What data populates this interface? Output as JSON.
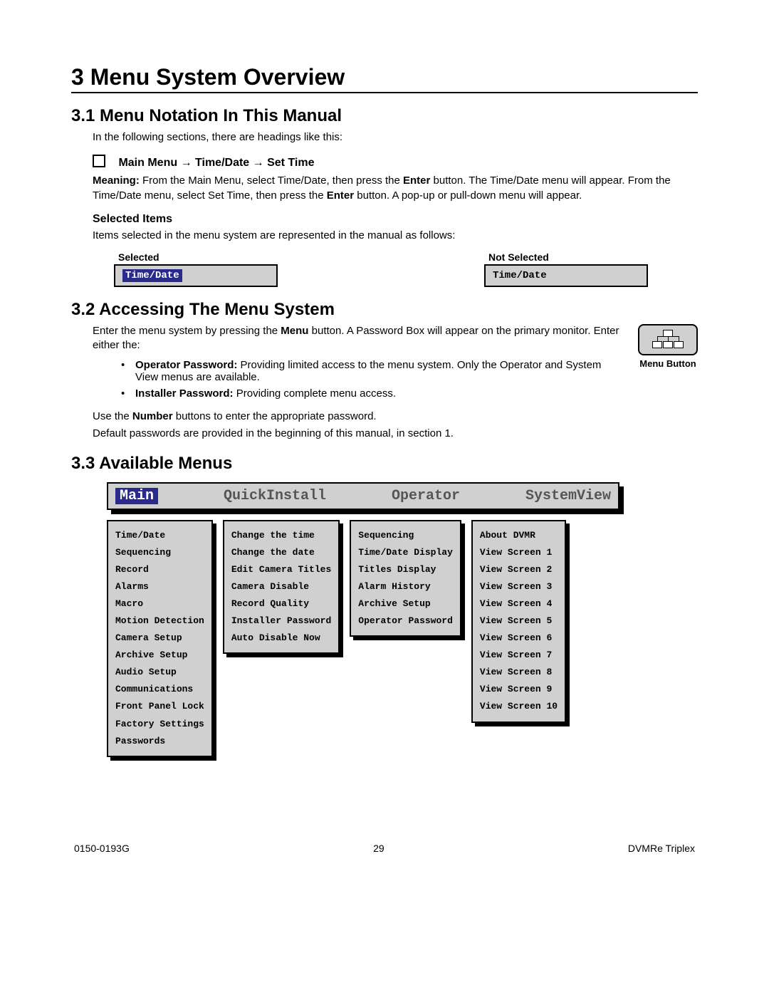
{
  "h1": "3 Menu System Overview",
  "s31": {
    "title": "3.1 Menu Notation In This Manual",
    "intro": "In the following sections, there are headings like this:",
    "path": "Main Menu → Time/Date → Set Time",
    "meaning_label": "Meaning:",
    "meaning1a": "  From the Main Menu, select Time/Date, then press the ",
    "enter1": "Enter",
    "meaning1b": " button.  The Time/Date menu will appear.  From the Time/Date menu, select Set Time, then press the ",
    "enter2": "Enter",
    "meaning1c": " button.  A pop-up or pull-down menu will appear.",
    "selected_items_h": "Selected Items",
    "selected_items_p": "Items selected in the menu system are represented in the manual as follows:",
    "sel_h": "Selected",
    "notsel_h": "Not Selected",
    "sel_v": "Time/Date",
    "notsel_v": "Time/Date"
  },
  "s32": {
    "title": "3.2 Accessing The Menu System",
    "p1a": "Enter the menu system by pressing the ",
    "p1menu": "Menu",
    "p1b": " button.  A Password Box will appear on the primary monitor.  Enter either the:",
    "b1_label": "Operator Password:",
    "b1_text": "  Providing limited access to the menu system.  Only the Operator and System View menus are available.",
    "b2_label": "Installer Password:",
    "b2_text": "  Providing complete menu access.",
    "p2a": "Use the ",
    "p2num": "Number",
    "p2b": " buttons to enter the appropriate password.",
    "p3": "Default passwords are provided in the beginning of this manual, in section 1.",
    "menu_button_caption": "Menu Button"
  },
  "s33": {
    "title": "3.3 Available Menus",
    "tabs": [
      "Main",
      "QuickInstall",
      "Operator",
      "SystemView"
    ],
    "cols": {
      "main": [
        "Time/Date",
        "Sequencing",
        "Record",
        "Alarms",
        "Macro",
        "Motion Detection",
        "Camera Setup",
        "Archive Setup",
        "Audio Setup",
        "Communications",
        "Front Panel Lock",
        "Factory Settings",
        "Passwords"
      ],
      "quickinstall": [
        "Change the time",
        "Change the date",
        "Edit Camera Titles",
        "Camera Disable",
        "Record Quality",
        "Installer Password",
        "Auto Disable Now"
      ],
      "operator": [
        "Sequencing",
        "Time/Date Display",
        "Titles Display",
        "Alarm History",
        "Archive Setup",
        "Operator Password"
      ],
      "systemview": [
        "About DVMR",
        "View Screen 1",
        "View Screen 2",
        "View Screen 3",
        "View Screen 4",
        "View Screen 5",
        "View Screen 6",
        "View Screen 7",
        "View Screen 8",
        "View Screen 9",
        "View Screen 10"
      ]
    }
  },
  "footer": {
    "left": "0150-0193G",
    "center": "29",
    "right": "DVMRe Triplex"
  }
}
